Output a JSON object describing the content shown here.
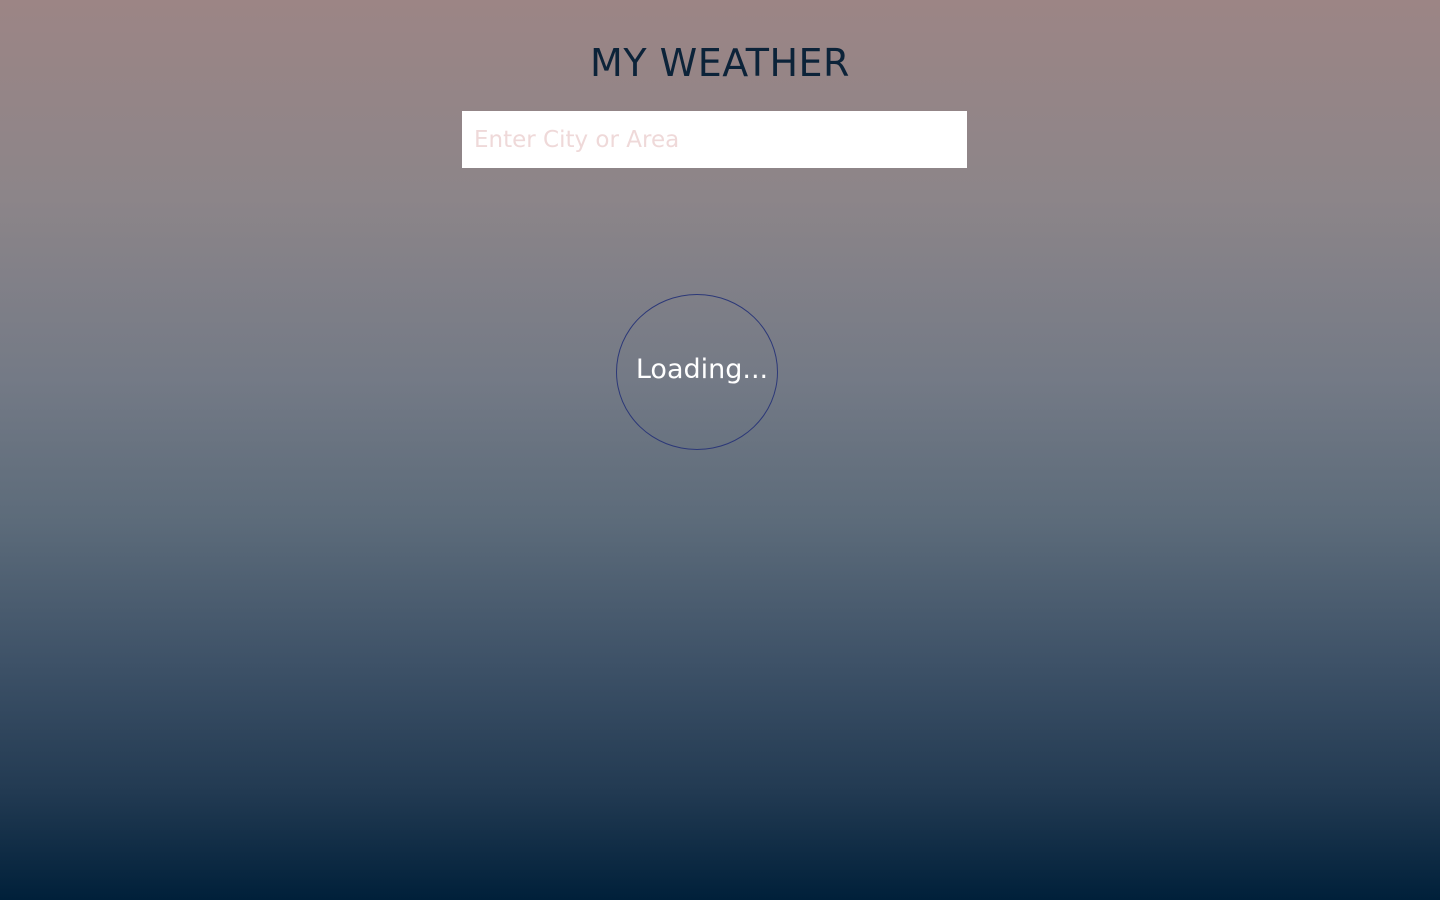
{
  "app": {
    "title": "MY WEATHER"
  },
  "search": {
    "placeholder": "Enter City or Area",
    "value": ""
  },
  "status": {
    "loading_text": "Loading..."
  },
  "colors": {
    "title": "#0c2339",
    "placeholder": "#efd9d9",
    "spinner_border": "#2c3878",
    "loading_text": "#ffffff",
    "background_top": "#9c8585",
    "background_bottom": "#00203a"
  }
}
